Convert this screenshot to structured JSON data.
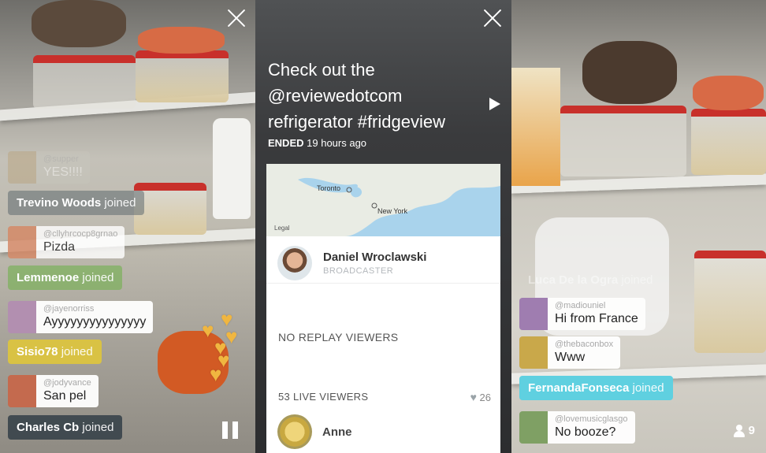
{
  "left_panel": {
    "faded_comment": {
      "username": "@supper",
      "message": "YES!!!!"
    },
    "events": [
      {
        "name": "Trevino Woods",
        "action": "joined",
        "color": "#5e6a70"
      },
      {
        "name": "Lemmenoe",
        "action": "joined",
        "color": "#7ab05a"
      },
      {
        "name": "Sisio78",
        "action": "joined",
        "color": "#d9c244"
      },
      {
        "name": "Charles Cb",
        "action": "joined",
        "color": "#3e4a52"
      }
    ],
    "comments": [
      {
        "username": "@cllyhrcocp8grnao",
        "message": "Pizda"
      },
      {
        "username": "@jayenorriss",
        "message": "Ayyyyyyyyyyyyyyy"
      },
      {
        "username": "@jodyvance",
        "message": "San pel"
      }
    ],
    "heart_color": "#f0b640"
  },
  "middle_panel": {
    "title": "Check out the @reviewedotcom refrigerator #fridgeview",
    "status_label": "ENDED",
    "status_time": "19 hours ago",
    "map": {
      "labels": [
        "Toronto",
        "New York"
      ],
      "legal": "Legal"
    },
    "broadcaster": {
      "name": "Daniel Wroclawski",
      "role": "BROADCASTER"
    },
    "replay_viewers": "NO REPLAY VIEWERS",
    "live_viewers": "53 LIVE VIEWERS",
    "likes": "26",
    "viewer_name": "Anne"
  },
  "right_panel": {
    "faded_event": {
      "name": "Luca De la Ogra",
      "action": "joined"
    },
    "comments": [
      {
        "username": "@madiouniel",
        "message": "Hi from France"
      },
      {
        "username": "@thebaconbox",
        "message": "Www"
      },
      {
        "username": "@lovemusicglasgo",
        "message": "No booze?"
      }
    ],
    "event": {
      "name": "FernandaFonseca",
      "action": "joined",
      "color": "#5fd0e0"
    },
    "viewer_count": "9"
  }
}
